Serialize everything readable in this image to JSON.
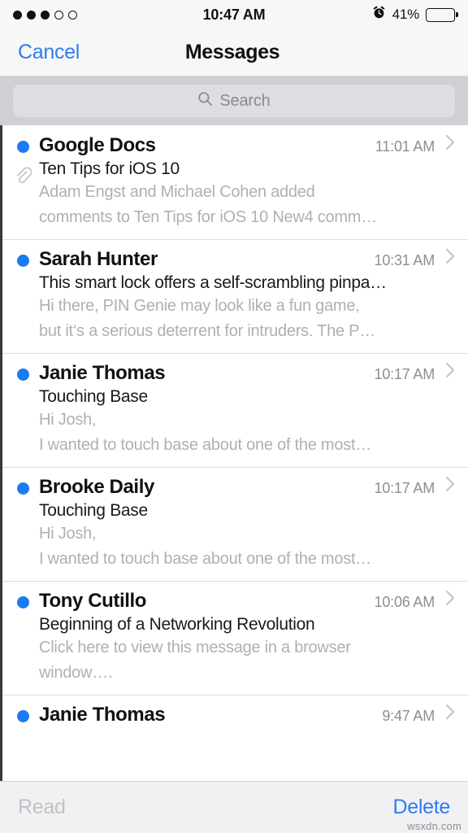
{
  "status_bar": {
    "signal": {
      "filled": 3,
      "total": 5
    },
    "time": "10:47 AM",
    "alarm_icon": "alarm-clock-icon",
    "battery_percent_label": "41%",
    "battery_level": 41,
    "battery_color": "#ffcc00"
  },
  "nav": {
    "cancel_label": "Cancel",
    "title": "Messages"
  },
  "search": {
    "icon": "search-icon",
    "placeholder": "Search",
    "value": ""
  },
  "colors": {
    "accent_blue": "#2f7cf6",
    "unread_dot": "#1a7cf0",
    "preview_gray": "#b0b0b4",
    "time_gray": "#8e8e93",
    "disabled_gray": "#c2c2c6"
  },
  "messages": [
    {
      "sender": "Google Docs",
      "time": "11:01 AM",
      "subject": "Ten Tips for iOS 10",
      "preview_line1": "Adam Engst and Michael Cohen added",
      "preview_line2": "comments to Ten Tips for iOS 10 New4 comm…",
      "unread": true,
      "has_attachment": true
    },
    {
      "sender": "Sarah Hunter",
      "time": "10:31 AM",
      "subject": "This smart lock offers a self-scrambling pinpa…",
      "preview_line1": "Hi there, PIN Genie may look like a fun game,",
      "preview_line2": "but it‘s a serious deterrent for intruders. The P…",
      "unread": true,
      "has_attachment": false
    },
    {
      "sender": "Janie Thomas",
      "time": "10:17 AM",
      "subject": "Touching Base",
      "preview_line1": "Hi Josh,",
      "preview_line2": "I wanted to touch base about one of the most…",
      "unread": true,
      "has_attachment": false
    },
    {
      "sender": "Brooke Daily",
      "time": "10:17 AM",
      "subject": "Touching Base",
      "preview_line1": "Hi Josh,",
      "preview_line2": "I wanted to touch base about one of the most…",
      "unread": true,
      "has_attachment": false
    },
    {
      "sender": "Tony Cutillo",
      "time": "10:06 AM",
      "subject": "Beginning of a Networking Revolution",
      "preview_line1": "Click here to view this message in a browser",
      "preview_line2": "window….",
      "unread": true,
      "has_attachment": false
    },
    {
      "sender": "Janie Thomas",
      "time": "9:47 AM",
      "subject": "",
      "preview_line1": "",
      "preview_line2": "",
      "unread": true,
      "has_attachment": false
    }
  ],
  "toolbar": {
    "read_label": "Read",
    "read_enabled": false,
    "delete_label": "Delete",
    "delete_enabled": true
  },
  "watermark": "wsxdn.com"
}
